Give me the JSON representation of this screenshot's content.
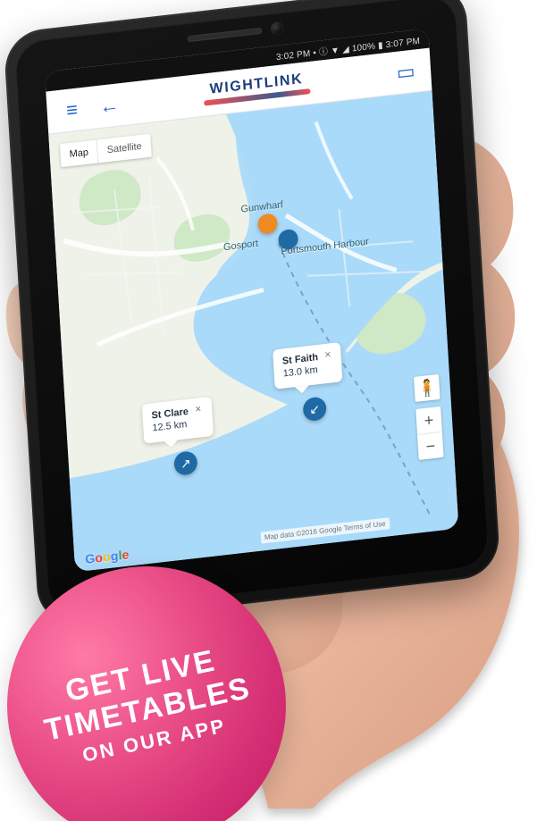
{
  "colors": {
    "map_water": "#aadaf9",
    "map_land": "#eef2e8",
    "map_green": "#cfe8c6",
    "app_accent": "#1c66c9",
    "promo_pink": "#ea4f87",
    "promo_deep": "#d42e74",
    "ship_blue": "#1f6aa5",
    "marker_orange": "#f08a24"
  },
  "status_bar": {
    "text": "3:02 PM  •  ⓘ  ▼  ◢  100%  ▮  3:07 PM"
  },
  "app_header": {
    "menu_icon": "menu-icon",
    "back_icon": "back-icon",
    "logo_text": "WIGHTLINK",
    "chat_icon": "chat-icon"
  },
  "map": {
    "map_type": {
      "map_label": "Map",
      "satellite_label": "Satellite"
    },
    "labels": {
      "gosport": "Gosport",
      "portsmouth_harbour": "Portsmouth Harbour",
      "gunwharf": "Gunwharf"
    },
    "callouts": [
      {
        "name": "St Clare",
        "distance": "12.5 km"
      },
      {
        "name": "St Faith",
        "distance": "13.0 km"
      }
    ],
    "controls": {
      "pegman_icon": "pegman-icon",
      "zoom_in": "+",
      "zoom_out": "−"
    },
    "attribution": "Map data ©2016 Google  Terms of Use",
    "google_logo": "Google"
  },
  "promo": {
    "line1": "GET LIVE",
    "line2": "TIMETABLES",
    "line3": "ON OUR APP"
  }
}
